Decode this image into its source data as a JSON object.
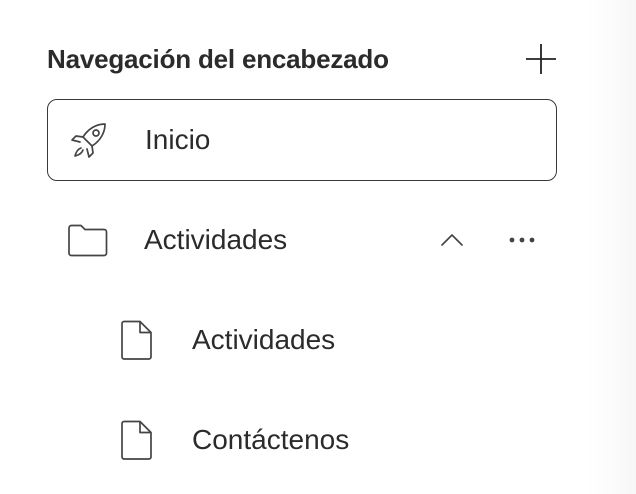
{
  "header": {
    "title": "Navegación del encabezado",
    "add_icon": "plus-icon"
  },
  "nav": {
    "items": [
      {
        "label": "Inicio",
        "icon": "rocket-icon",
        "selected": true,
        "level": 0
      },
      {
        "label": "Actividades",
        "icon": "folder-icon",
        "expanded": true,
        "level": 0,
        "toggle_icon": "chevron-up-icon",
        "more_icon": "more-horizontal-icon"
      },
      {
        "label": "Actividades",
        "icon": "file-icon",
        "level": 1
      },
      {
        "label": "Contáctenos",
        "icon": "file-icon",
        "level": 1
      }
    ]
  },
  "colors": {
    "text": "#2b2b2b",
    "border": "#3a3a3a",
    "icon": "#444444",
    "background": "#ffffff"
  }
}
